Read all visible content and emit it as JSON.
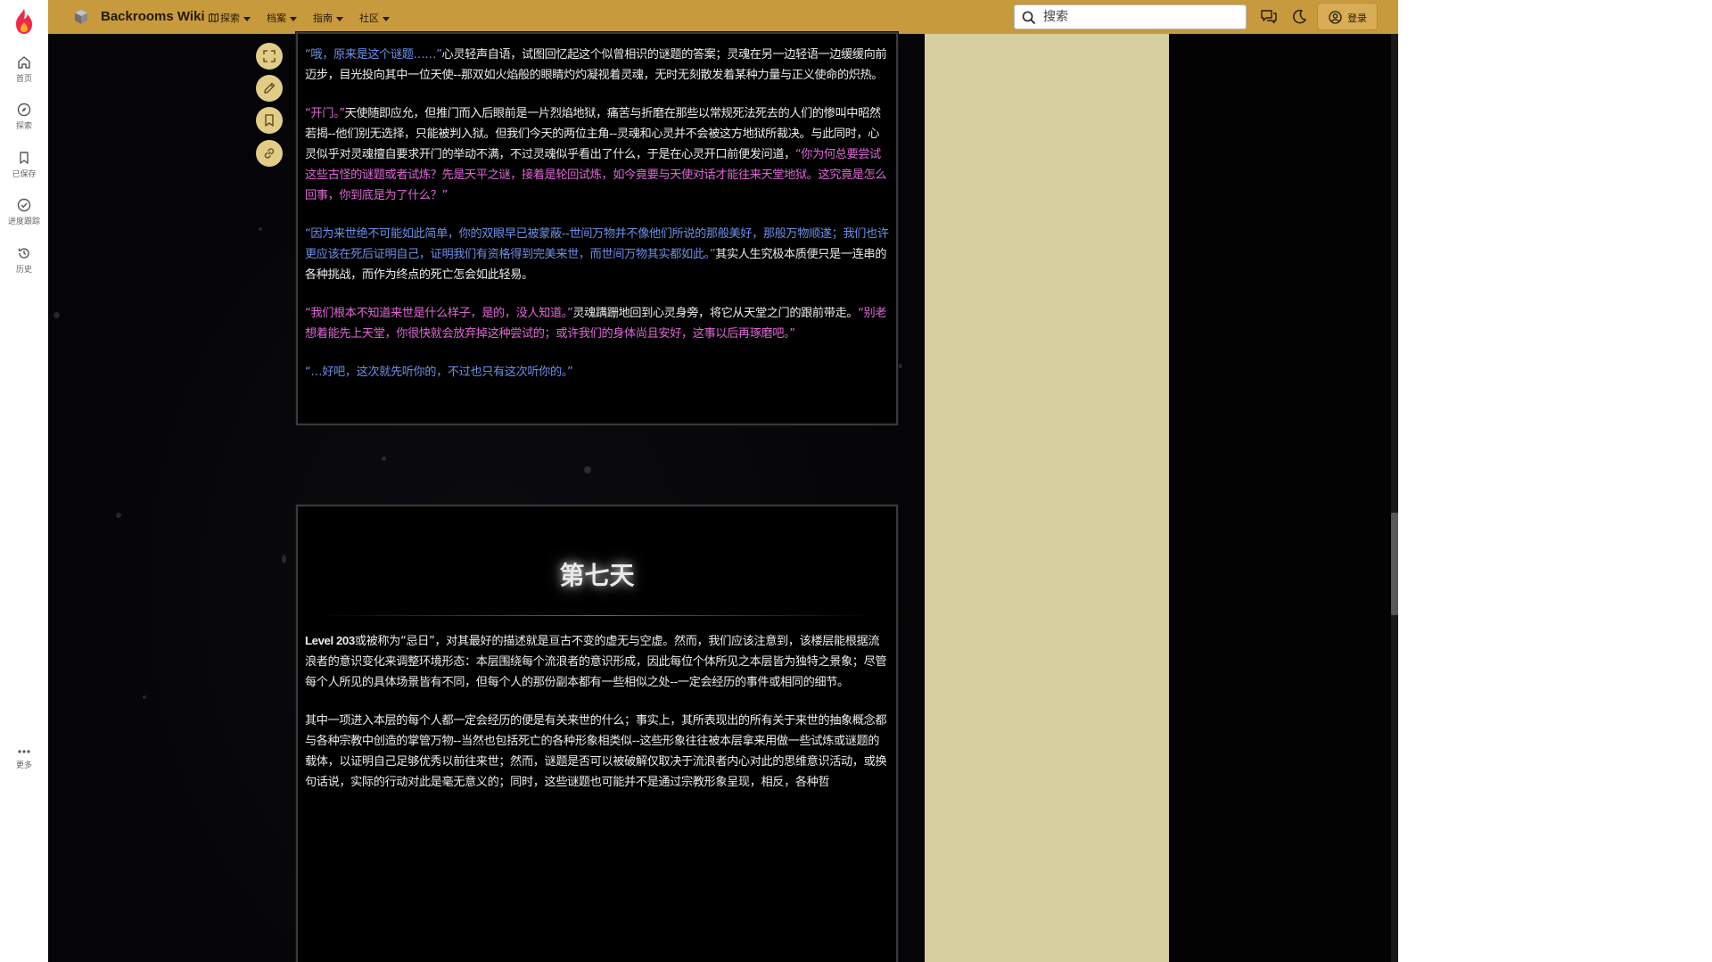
{
  "sidebar": {
    "items": [
      {
        "label": "首页",
        "icon": "home-icon"
      },
      {
        "label": "探索",
        "icon": "compass-icon"
      },
      {
        "label": "已保存",
        "icon": "bookmark-icon"
      },
      {
        "label": "进度跟踪",
        "icon": "check-circle-icon"
      },
      {
        "label": "历史",
        "icon": "history-icon"
      }
    ],
    "more_label": "更多"
  },
  "header": {
    "site_title": "Backrooms Wiki",
    "nav": [
      {
        "label": "探索",
        "icon": "map-icon"
      },
      {
        "label": "档案"
      },
      {
        "label": "指南"
      },
      {
        "label": "社区"
      }
    ],
    "search_placeholder": "搜索",
    "login_label": "登录"
  },
  "colors": {
    "topbar": "#c89a3e",
    "sidebar_panel": "#d5ce9e",
    "dialogue_blue": "#6d8fe6",
    "dialogue_pink": "#de67d6",
    "tool_button": "#e2cd88"
  },
  "page_tools": [
    "fullscreen-icon",
    "edit-icon",
    "bookmark-icon",
    "link-icon"
  ],
  "story_top": {
    "p1": [
      {
        "t": "“哦，原来是这个谜题……”",
        "c": "blue"
      },
      {
        "t": "心灵轻声自语，试图回忆起这个似曾相识的谜题的答案；灵魂在另一边轻语一边缓缓向前迈步，目光投向其中一位天使--那双如火焰般的眼睛灼灼凝视着灵魂，无时无刻散发着某种力量与正义使命的炽热。",
        "c": "white"
      }
    ],
    "p2": [
      {
        "t": "“开门。”",
        "c": "pink"
      },
      {
        "t": "天使随即应允，但推门而入后眼前是一片烈焰地狱，痛苦与折磨在那些以常规死法死去的人们的惨叫中昭然若揭--他们别无选择，只能被判入狱。但我们今天的两位主角--灵魂和心灵并不会被这方地狱所裁决。与此同时，心灵似乎对灵魂擅自要求开门的举动不满，不过灵魂似乎看出了什么，于是在心灵开口前便发问道，",
        "c": "white"
      },
      {
        "t": "“你为何总要尝试这些古怪的谜题或者试炼？先是天平之谜，接着是轮回试炼，如今竟要与天使对话才能往来天堂地狱。这究竟是怎么回事，你到底是为了什么？”",
        "c": "pink"
      }
    ],
    "p3": [
      {
        "t": "“因为来世绝不可能如此简单，你的双眼早已被蒙蔽--世间万物并不像他们所说的那般美好，那般万物顺遂；我们也许更应该在死后证明自己，证明我们有资格得到完美来世，而世间万物其实都如此。”",
        "c": "blue"
      },
      {
        "t": "其实人生究极本质便只是一连串的各种挑战，而作为终点的死亡怎会如此轻易。",
        "c": "white"
      }
    ],
    "p4": [
      {
        "t": "“我们根本不知道来世是什么样子，是的，没人知道。”",
        "c": "pink"
      },
      {
        "t": "灵魂蹒跚地回到心灵身旁，将它从天堂之门的跟前带走。",
        "c": "white"
      },
      {
        "t": "“别老想着能先上天堂，你很快就会放弃掉这种尝试的；或许我们的身体尚且安好，这事以后再琢磨吧。”",
        "c": "pink"
      }
    ],
    "p5": [
      {
        "t": "“…好吧，这次就先听你的，不过也只有这次听你的。”",
        "c": "blue"
      }
    ]
  },
  "story_bottom": {
    "day_title": "第七天",
    "p1_bold": "Level 203",
    "p1_rest": "或被称为“忌日”，对其最好的描述就是亘古不变的虚无与空虚。然而，我们应该注意到，该楼层能根据流浪者的意识变化来调整环境形态：本层围绕每个流浪者的意识形成，因此每位个体所见之本层皆为独特之景象；尽管每个人所见的具体场景皆有不同，但每个人的那份副本都有一些相似之处--一定会经历的事件或相同的细节。",
    "p2": "其中一项进入本层的每个人都一定会经历的便是有关来世的什么；事实上，其所表现出的所有关于来世的抽象概念都与各种宗教中创造的掌管万物--当然也包括死亡的各种形象相类似--这些形象往往被本层拿来用做一些试炼或谜题的载体，以证明自己足够优秀以前往来世；然而，谜题是否可以被破解仅取决于流浪者内心对此的思维意识活动，或换句话说，实际的行动对此是毫无意义的；同时，这些谜题也可能并不是通过宗教形象呈现，相反，各种哲"
  }
}
